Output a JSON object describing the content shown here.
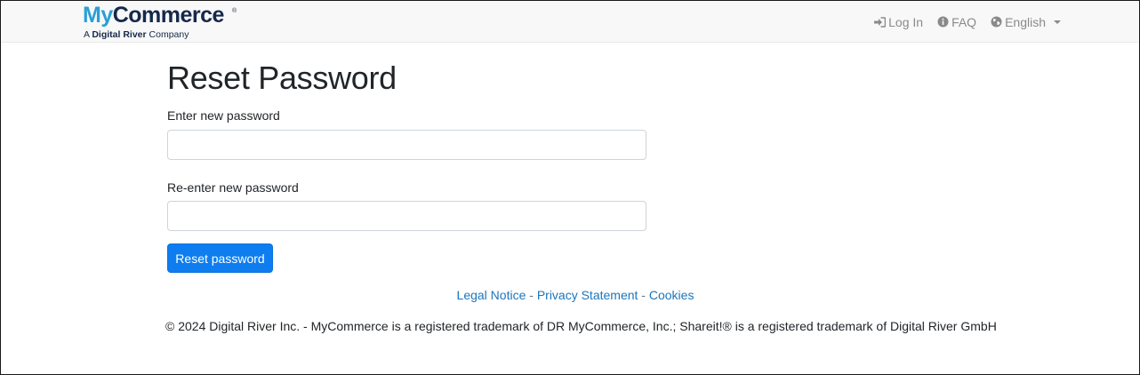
{
  "header": {
    "logo": {
      "my": "My",
      "commerce": "Commerce",
      "registered": "®",
      "tagline_prefix": "A ",
      "tagline_brand": "Digital River",
      "tagline_suffix": " Company"
    },
    "nav": {
      "login_label": "Log In",
      "faq_label": "FAQ",
      "language_label": "English"
    }
  },
  "main": {
    "title": "Reset Password",
    "new_password_label": "Enter new password",
    "new_password_value": "",
    "confirm_password_label": "Re-enter new password",
    "confirm_password_value": "",
    "submit_label": "Reset password"
  },
  "footer": {
    "legal_notice": "Legal Notice",
    "privacy_statement": "Privacy Statement",
    "cookies": "Cookies",
    "separator": " - ",
    "copyright": "© 2024 Digital River Inc. - MyCommerce is a registered trademark of DR MyCommerce, Inc.; Shareit!® is a registered trademark of Digital River GmbH"
  },
  "colors": {
    "primary_button": "#0e7df0",
    "link": "#1c75bc",
    "logo_blue": "#2a9fd6",
    "logo_navy": "#15294b",
    "nav_text": "#8a8a8a"
  },
  "icons": {
    "login": "sign-in-icon",
    "faq": "info-circle-icon",
    "language": "globe-icon"
  }
}
